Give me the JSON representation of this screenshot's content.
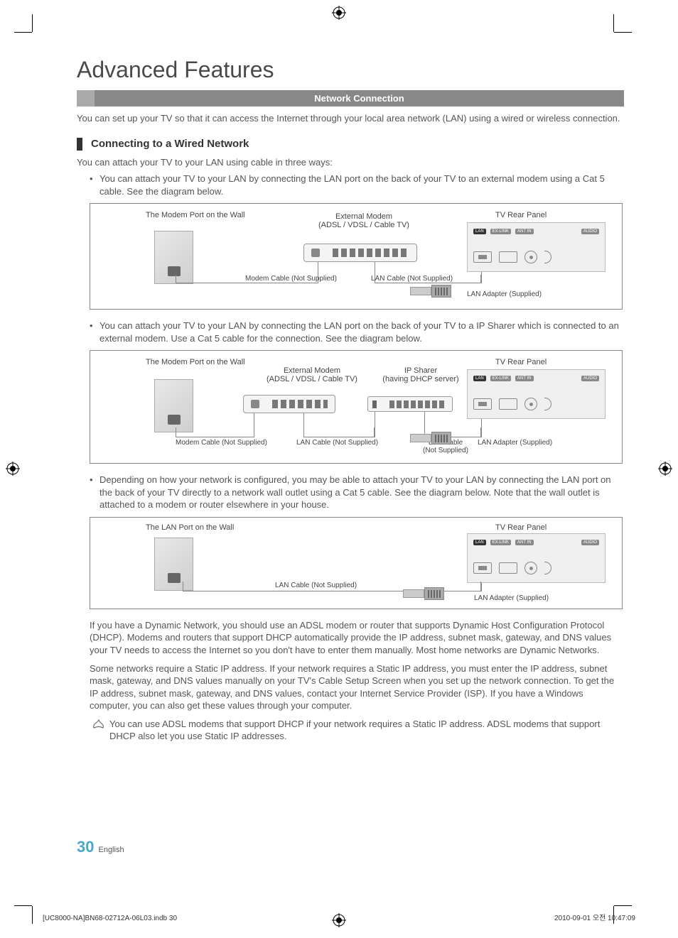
{
  "title": "Advanced Features",
  "section_bar": "Network Connection",
  "intro": "You can set up your TV so that it can access the Internet through your local area network (LAN) using a wired or wireless connection.",
  "sub_heading": "Connecting to a Wired Network",
  "lead": "You can attach your TV to your LAN using cable in three ways:",
  "bullet1": "You can attach your TV to your LAN by connecting the LAN port on the back of your TV to an external modem using a Cat 5 cable. See the diagram below.",
  "bullet2": "You can attach your TV to your LAN by connecting the LAN port on the back of your TV to a IP Sharer which is connected to an external modem. Use a Cat 5 cable for the connection. See the diagram below.",
  "bullet3": "Depending on how your network is configured, you may be able to attach your TV to your LAN by connecting the LAN port on the back of your TV directly to a network wall outlet using a Cat 5 cable. See the diagram below. Note that the wall outlet is attached to a modem or router elsewhere in your house.",
  "diagram": {
    "modem_port_wall": "The Modem Port on the Wall",
    "lan_port_wall": "The LAN Port on the Wall",
    "external_modem": "External Modem",
    "external_modem_sub": "(ADSL / VDSL / Cable TV)",
    "ip_sharer": "IP Sharer",
    "ip_sharer_sub": "(having DHCP server)",
    "tv_rear_panel": "TV Rear Panel",
    "modem_cable": "Modem Cable (Not Supplied)",
    "lan_cable": "LAN Cable (Not Supplied)",
    "lan_cable_short": "LAN Cable",
    "not_supplied": "(Not Supplied)",
    "lan_adapter": "LAN Adapter (Supplied)",
    "port_lan": "LAN",
    "port_exlink": "EX-LINK",
    "port_antin": "ANT IN",
    "port_audio": "AUDIO"
  },
  "para1": "If you have a Dynamic Network, you should use an ADSL modem or router that supports Dynamic Host Configuration Protocol (DHCP). Modems and routers that support DHCP automatically provide the IP address, subnet mask, gateway, and DNS values your TV needs to access the Internet so you don't have to enter them manually. Most home networks are Dynamic Networks.",
  "para2": "Some networks require a Static IP address. If your network requires a Static IP address, you must enter the IP address, subnet mask, gateway, and DNS values manually on your TV's Cable Setup Screen when you set up the network connection. To get the IP address, subnet mask, gateway, and DNS values, contact your Internet Service Provider (ISP). If you have a Windows computer, you can also get these values through your computer.",
  "note": "You can use ADSL modems that support DHCP if your network requires a Static IP address. ADSL modems that support DHCP also let you use Static IP addresses.",
  "page_number": "30",
  "page_lang": "English",
  "footer_left": "[UC8000-NA]BN68-02712A-06L03.indb   30",
  "footer_right": "2010-09-01   오전 10:47:09"
}
